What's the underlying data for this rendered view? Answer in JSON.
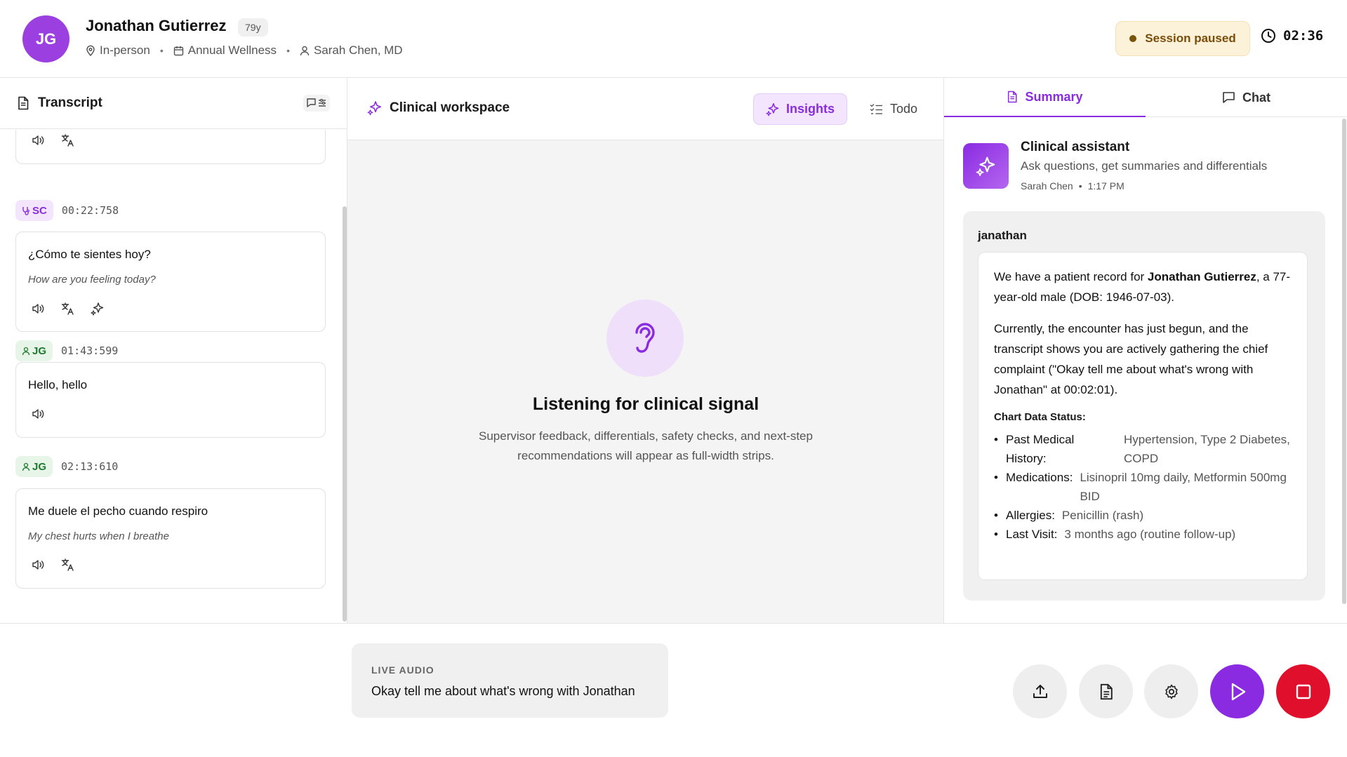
{
  "header": {
    "avatar_initials": "JG",
    "patient_name": "Jonathan Gutierrez",
    "age": "79y",
    "visit_mode": "In-person",
    "visit_type": "Annual Wellness",
    "provider": "Sarah Chen, MD",
    "session_status": "Session paused",
    "timer": "02:36"
  },
  "transcript": {
    "title": "Transcript",
    "entries": [
      {
        "speaker": "SC",
        "time": "00:22:758",
        "text": "¿Cómo te sientes hoy?",
        "translation": "How are you feeling today?"
      },
      {
        "speaker": "JG",
        "time": "01:43:599",
        "text": "Hello, hello",
        "translation": ""
      },
      {
        "speaker": "JG",
        "time": "02:13:610",
        "text": "Me duele el pecho cuando respiro",
        "translation": "My chest hurts when I breathe"
      }
    ]
  },
  "workspace": {
    "title": "Clinical workspace",
    "tabs": {
      "insights": "Insights",
      "todo": "Todo"
    },
    "empty_title": "Listening for clinical signal",
    "empty_desc": "Supervisor feedback, differentials, safety checks, and next-step recommendations will appear as full-width strips."
  },
  "right_panel": {
    "tabs": {
      "summary": "Summary",
      "chat": "Chat"
    },
    "assistant_title": "Clinical assistant",
    "assistant_subtitle": "Ask questions, get summaries and differentials",
    "assistant_author": "Sarah Chen",
    "assistant_time": "1:17 PM",
    "chat_user": "janathan",
    "reply_p1_a": "We have a patient record for ",
    "reply_p1_name": "Jonathan Gutierrez",
    "reply_p1_b": ", a 77-year-old male (DOB: 1946-07-03).",
    "reply_p2": "Currently, the encounter has just begun, and the transcript shows you are actively gathering the chief complaint (\"Okay tell me about what's wrong with Jonathan\" at 00:02:01).",
    "chart_status_heading": "Chart Data Status:",
    "chart_status": [
      {
        "key": "Past Medical History:",
        "value": "Hypertension, Type 2 Diabetes, COPD"
      },
      {
        "key": "Medications:",
        "value": "Lisinopril 10mg daily, Metformin 500mg BID"
      },
      {
        "key": "Allergies:",
        "value": "Penicillin (rash)"
      },
      {
        "key": "Last Visit:",
        "value": "3 months ago (routine follow-up)"
      }
    ]
  },
  "bottom": {
    "live_label": "LIVE AUDIO",
    "live_text": "Okay tell me about what's wrong with Jonathan"
  },
  "colors": {
    "accent": "#8a2be2",
    "stop": "#e0102c",
    "paused_bg": "#fcf1d9",
    "sc_tag_bg": "#f2e5fd",
    "jg_tag_bg": "#e6f5e8"
  },
  "icons": [
    "location-pin-icon",
    "calendar-icon",
    "person-icon",
    "clock-icon",
    "document-icon",
    "chat-filter-icon",
    "speaker-icon",
    "translate-icon",
    "sparkle-icon",
    "checklist-icon",
    "ear-icon",
    "chat-bubble-icon",
    "upload-icon",
    "gear-icon",
    "play-icon",
    "stop-icon"
  ]
}
